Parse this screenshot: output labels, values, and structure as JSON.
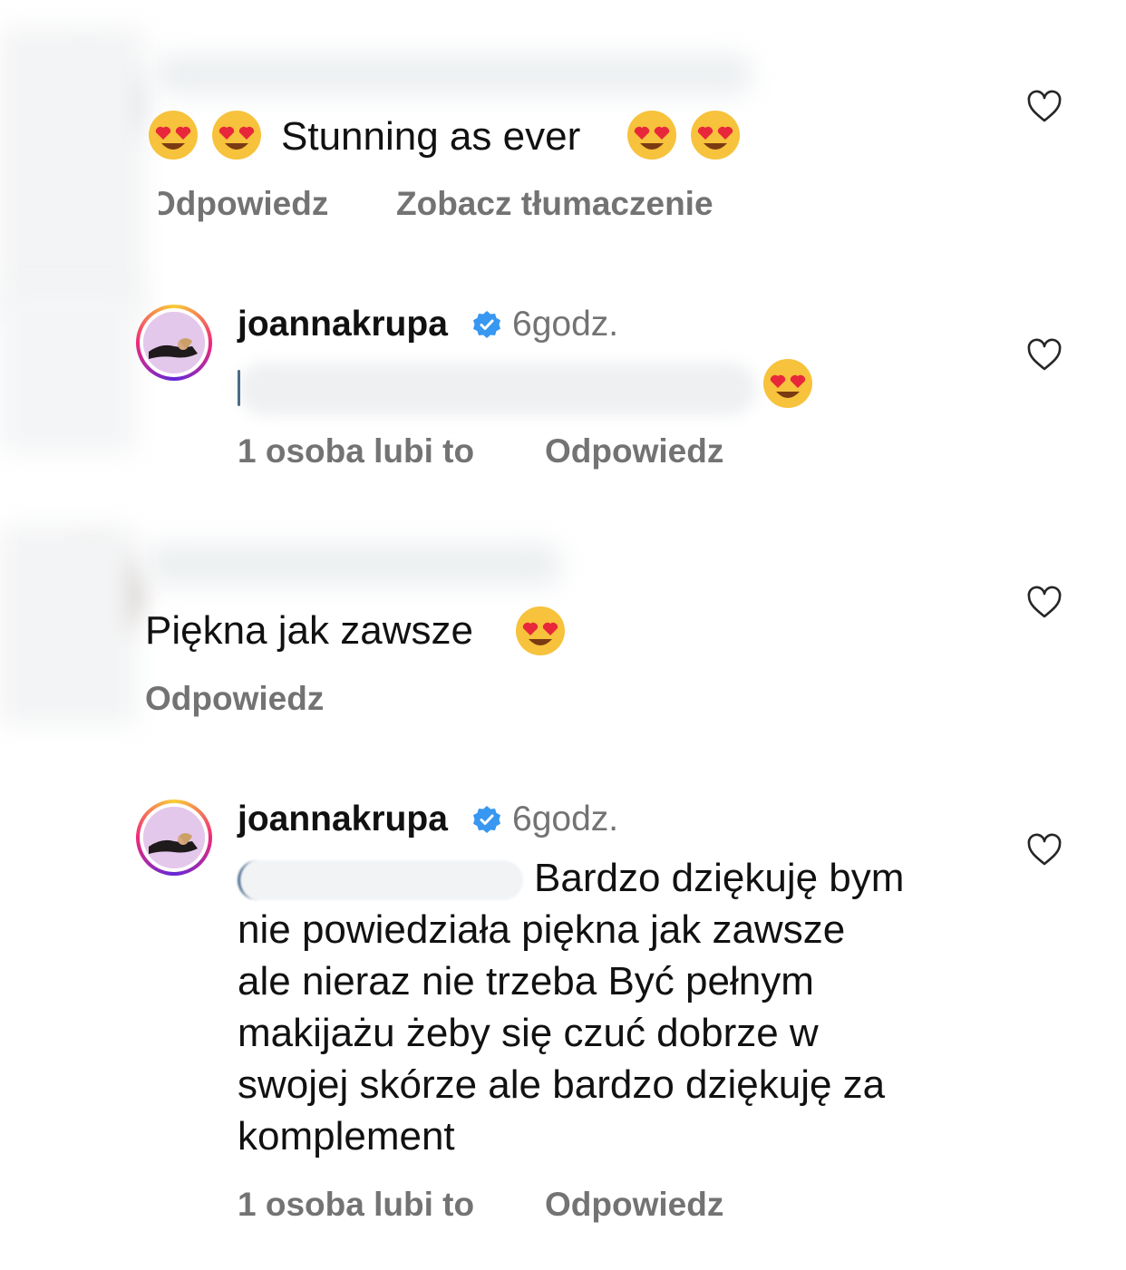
{
  "comments": [
    {
      "text": "Stunning as ever",
      "actions": {
        "reply": "Odpowiedz",
        "translate": "Zobacz tłumaczenie"
      }
    },
    {
      "username": "joannakrupa",
      "time": "6godz.",
      "likes": "1 osoba lubi to",
      "reply": "Odpowiedz"
    },
    {
      "text": "Piękna jak zawsze",
      "reply": "Odpowiedz"
    },
    {
      "username": "joannakrupa",
      "time": "6godz.",
      "lines": [
        "Bardzo dziękuję bym",
        "nie powiedziała piękna jak zawsze",
        "ale nieraz nie trzeba Być pełnym",
        "makijażu żeby się czuć dobrze w",
        "swojej skórze ale bardzo dziękuję za",
        "komplement"
      ],
      "likes": "1 osoba lubi to",
      "reply": "Odpowiedz"
    }
  ],
  "icons": {
    "like": "heart-outline-icon",
    "verified": "verified-badge-icon",
    "emoji": "heart-eyes-emoji"
  },
  "colors": {
    "text": "#111111",
    "meta": "#737373",
    "verified": "#3897f0",
    "heart_stroke": "#262626"
  }
}
